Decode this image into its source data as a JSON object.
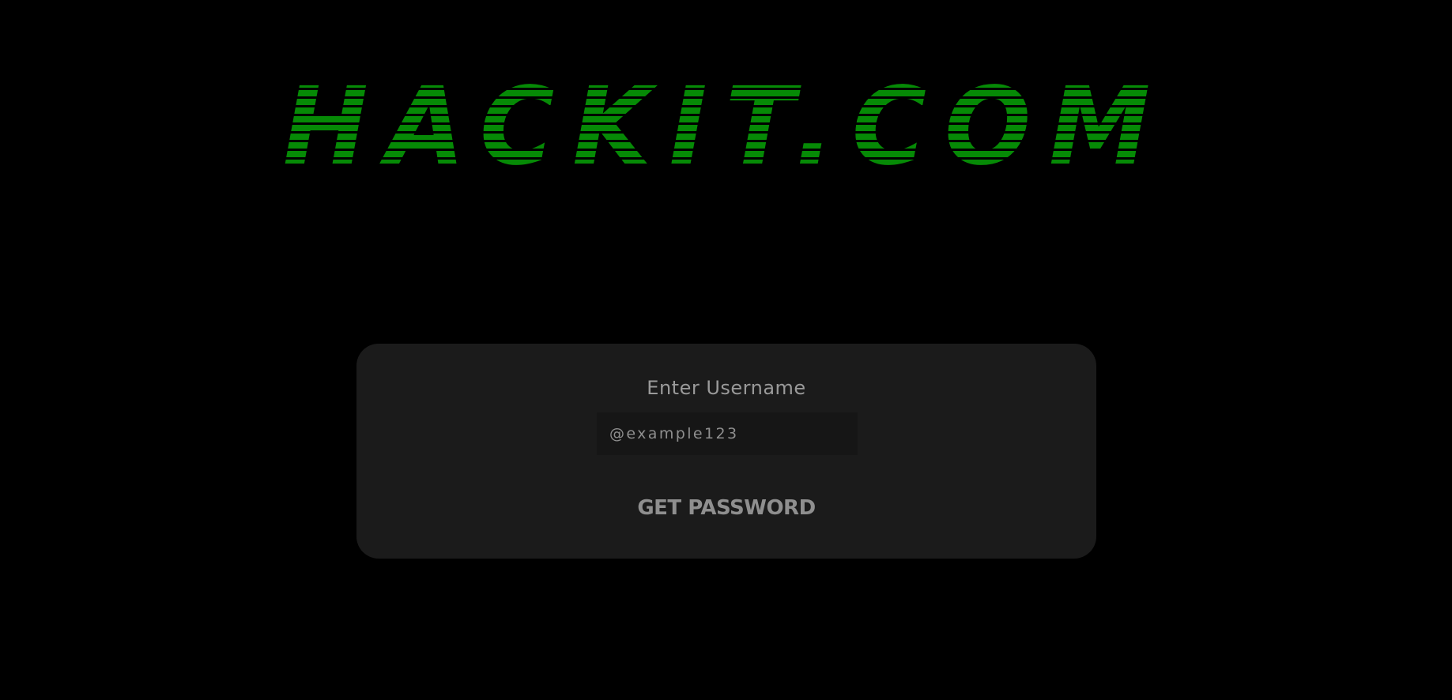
{
  "logo": {
    "text": "HACKIT.COM",
    "color": "#068a06"
  },
  "form": {
    "label": "Enter Username",
    "username_placeholder": "@example123",
    "username_value": "",
    "submit_label": "GET PASSWORD"
  },
  "colors": {
    "background": "#000000",
    "card": "#1b1b1b",
    "input": "#161616",
    "muted_text": "#9a9a9a"
  }
}
